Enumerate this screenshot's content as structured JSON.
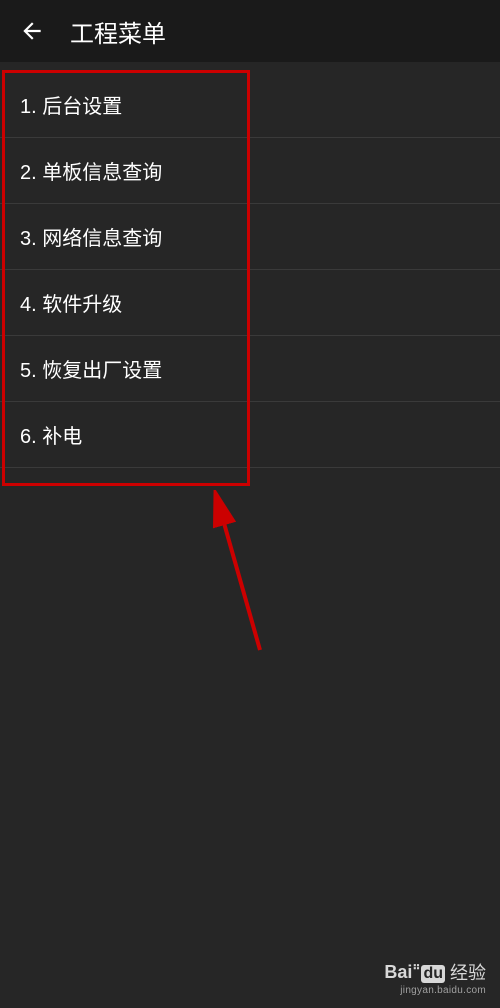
{
  "header": {
    "title": "工程菜单"
  },
  "menu": {
    "items": [
      {
        "label": "1. 后台设置"
      },
      {
        "label": "2. 单板信息查询"
      },
      {
        "label": "3. 网络信息查询"
      },
      {
        "label": "4. 软件升级"
      },
      {
        "label": "5. 恢复出厂设置"
      },
      {
        "label": "6. 补电"
      }
    ]
  },
  "watermark": {
    "brand_left": "Bai",
    "brand_mid": "du",
    "brand_text": "经验",
    "url": "jingyan.baidu.com"
  }
}
